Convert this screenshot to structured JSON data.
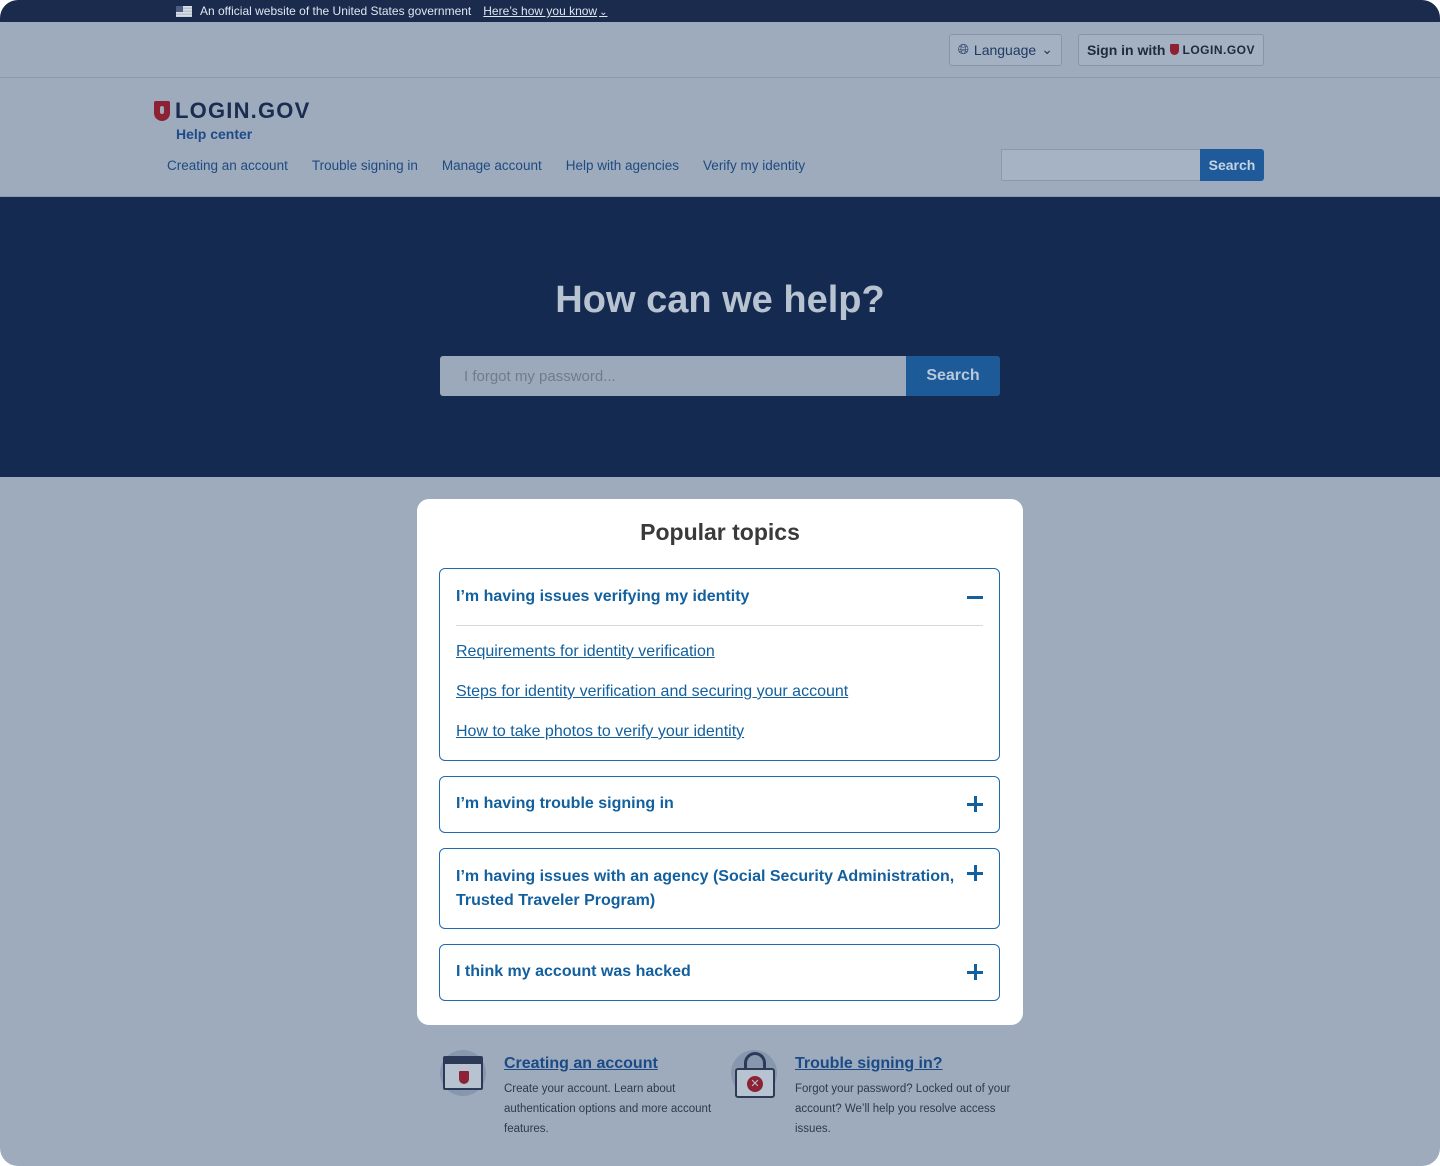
{
  "gov_banner": {
    "text": "An official website of the United States government",
    "link": "Here’s how you know"
  },
  "utility": {
    "language_label": "Language",
    "sign_in_prefix": "Sign in with",
    "sign_in_brand": "LOGIN.GOV"
  },
  "header": {
    "brand": "LOGIN.GOV",
    "subtitle": "Help center",
    "nav": [
      "Creating an account",
      "Trouble signing in",
      "Manage account",
      "Help with agencies",
      "Verify my identity"
    ],
    "search_button": "Search"
  },
  "hero": {
    "title": "How can we help?",
    "search_placeholder": "I forgot my password...",
    "search_button": "Search"
  },
  "modal": {
    "title": "Popular topics",
    "accordions": [
      {
        "title": "I’m having issues verifying my identity",
        "expanded": true,
        "links": [
          "Requirements for identity verification",
          "Steps for identity verification and securing your account",
          "How to take photos to verify your identity"
        ]
      },
      {
        "title": "I’m having trouble signing in",
        "expanded": false
      },
      {
        "title": "I’m having issues with an agency (Social Security Administration, Trusted Traveler Program)",
        "expanded": false
      },
      {
        "title": "I think my account was hacked",
        "expanded": false
      }
    ]
  },
  "features": [
    {
      "title": "Creating an account",
      "text": "Create your account. Learn about authentication options and more account features.",
      "icon": "browser-shield-icon"
    },
    {
      "title": "Trouble signing in?",
      "text": "Forgot your password? Locked out of your account? We’ll help you resolve access issues.",
      "icon": "lock-icon"
    }
  ],
  "colors": {
    "hero_bg": "#142a50",
    "overlay_bg": "#9dabbd",
    "link_blue": "#13609e",
    "brand_red": "#8c2234"
  }
}
